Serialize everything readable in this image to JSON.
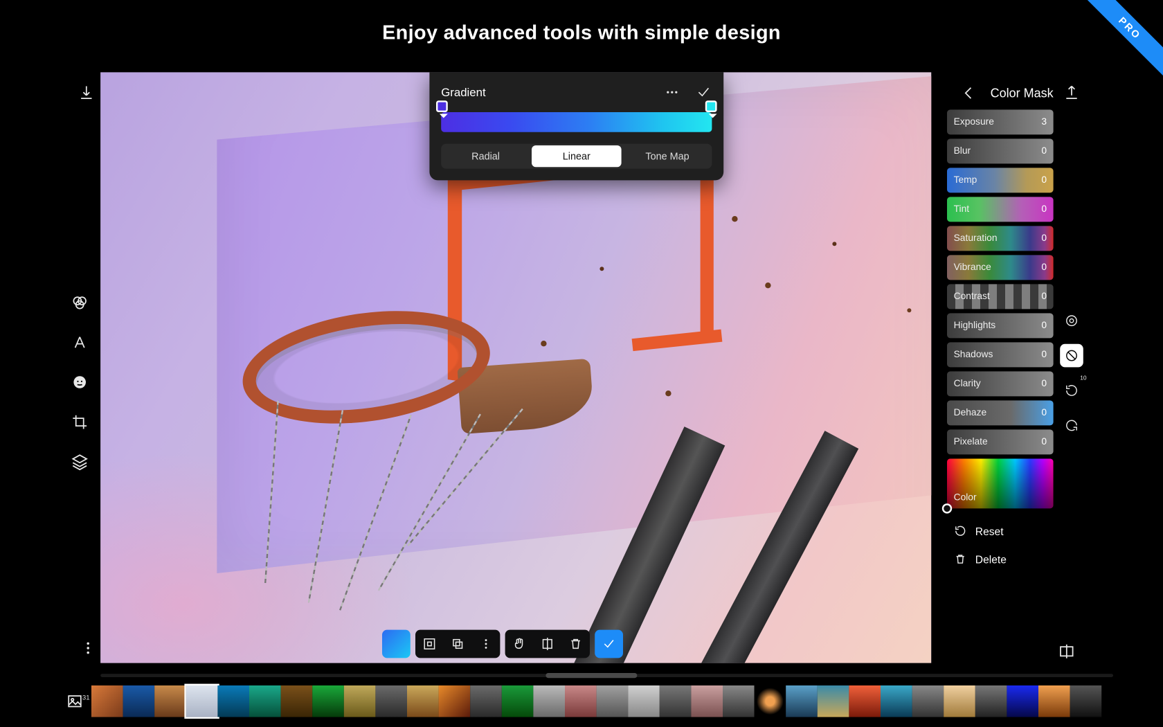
{
  "headline": "Enjoy advanced tools with simple design",
  "ribbon": "PRO",
  "panel": {
    "title": "Color Mask",
    "sliders": [
      {
        "label": "Exposure",
        "value": "3",
        "bg": "bg-gray"
      },
      {
        "label": "Blur",
        "value": "0",
        "bg": "bg-gray"
      },
      {
        "label": "Temp",
        "value": "0",
        "bg": "bg-temp"
      },
      {
        "label": "Tint",
        "value": "0",
        "bg": "bg-tint"
      },
      {
        "label": "Saturation",
        "value": "0",
        "bg": "bg-sat"
      },
      {
        "label": "Vibrance",
        "value": "0",
        "bg": "bg-vib"
      },
      {
        "label": "Contrast",
        "value": "0",
        "bg": "bg-contrast"
      },
      {
        "label": "Highlights",
        "value": "0",
        "bg": "bg-gray"
      },
      {
        "label": "Shadows",
        "value": "0",
        "bg": "bg-gray"
      },
      {
        "label": "Clarity",
        "value": "0",
        "bg": "bg-gray"
      },
      {
        "label": "Dehaze",
        "value": "0",
        "bg": "bg-dehaze"
      },
      {
        "label": "Pixelate",
        "value": "0",
        "bg": "bg-gray"
      }
    ],
    "color_label": "Color",
    "reset": "Reset",
    "delete": "Delete"
  },
  "gradient": {
    "title": "Gradient",
    "tabs": [
      "Radial",
      "Linear",
      "Tone Map"
    ],
    "active": "Linear",
    "stops": [
      "#4d2fe3",
      "#23e6f0"
    ]
  },
  "mini_history_badge": "10",
  "filmstrip": {
    "count": "31",
    "thumbs": [
      "linear-gradient(135deg,#d97a3a,#7a3a1a)",
      "linear-gradient(#1a5aa8,#0a2a55)",
      "linear-gradient(#c78a4a,#6a3a1a)",
      "linear-gradient(180deg,#dde4ee,#a9b2c4)",
      "linear-gradient(#0a7ab8,#033a55)",
      "linear-gradient(#1aa88a,#05503a)",
      "linear-gradient(#7a501a,#3a2505)",
      "linear-gradient(#1aa83a,#053a0a)",
      "linear-gradient(#bfa85a,#6a5a1a)",
      "linear-gradient(#6a6a6a,#2a2a2a)",
      "linear-gradient(#caa85a,#7a4a1a)",
      "linear-gradient(135deg,#e88a2a,#5a1a0a)",
      "linear-gradient(#6a6a6a,#2a2a2a)",
      "linear-gradient(#1a9a3a,#054a0a)",
      "linear-gradient(#bababa,#6a6a6a)",
      "linear-gradient(#c88888,#7a3a3a)",
      "linear-gradient(#a0a0a0,#555)",
      "linear-gradient(#d0d0d0,#888)",
      "linear-gradient(#777,#333)",
      "linear-gradient(#caa0a0,#7a5050)",
      "linear-gradient(#888,#333)",
      "radial-gradient(circle,#f0a050 0 20%,#000 60%)",
      "linear-gradient(#5aa0c8,#1a3a55)",
      "linear-gradient(#3a8aa8,#c8a85a)",
      "linear-gradient(#f0603a,#7a1a0a)",
      "linear-gradient(#3aa8c8,#0a3a55)",
      "linear-gradient(#888,#333)",
      "linear-gradient(#f0d0a0,#a07a3a)",
      "linear-gradient(#777,#222)",
      "linear-gradient(#1a2af0,#05084a)",
      "linear-gradient(#f0a050,#7a3a0a)",
      "linear-gradient(#555,#111)"
    ],
    "selected_index": 3
  }
}
